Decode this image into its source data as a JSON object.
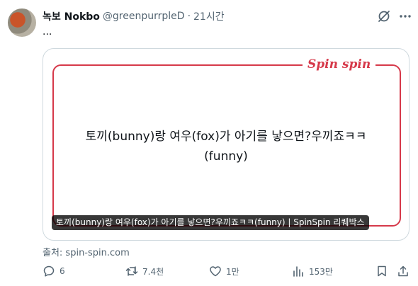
{
  "author": {
    "name": "녹보 Nokbo",
    "handle": "@greenpurrpleD",
    "separator": "·",
    "time": "21시간"
  },
  "tweet": {
    "text": "..."
  },
  "card": {
    "brand": "Spin spin",
    "headline": "토끼(bunny)랑 여우(fox)가 아기를 낳으면?우끼죠ㅋㅋ(funny)",
    "caption": "토끼(bunny)랑 여우(fox)가 아기를 낳으면?우끼죠ㅋㅋ(funny) | SpinSpin 리퀘박스",
    "brand_color": "#d6394a"
  },
  "source": "출처: spin-spin.com",
  "actions": {
    "replies": "6",
    "retweets": "7.4천",
    "likes": "1만",
    "views": "153만"
  },
  "icons": [
    "grok-icon",
    "more-icon",
    "reply-icon",
    "retweet-icon",
    "like-icon",
    "views-icon",
    "bookmark-icon",
    "share-icon"
  ]
}
